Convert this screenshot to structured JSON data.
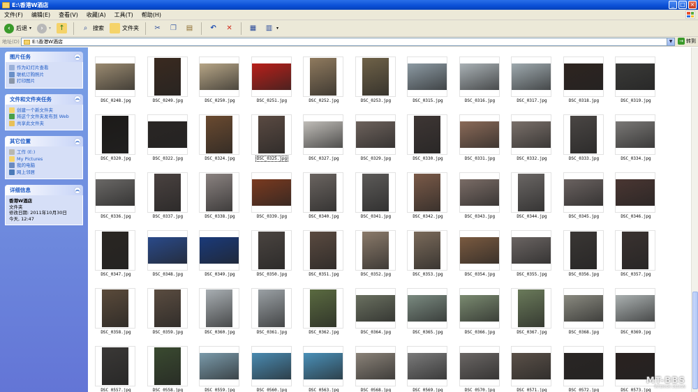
{
  "window": {
    "title": "E:\\香港W酒店"
  },
  "menu": [
    "文件(F)",
    "编辑(E)",
    "查看(V)",
    "收藏(A)",
    "工具(T)",
    "帮助(H)"
  ],
  "toolbar": {
    "back": "后退",
    "search": "搜索",
    "folders": "文件夹"
  },
  "address": {
    "label": "地址(D)",
    "path": "E:\\香港W酒店",
    "go": "转到"
  },
  "tasks_panels": [
    {
      "title": "图片任务",
      "items": [
        "作为幻灯片查看",
        "联机订购照片",
        "打印图片"
      ]
    },
    {
      "title": "文件和文件夹任务",
      "items": [
        "创建一个新文件夹",
        "将这个文件夹发布到 Web",
        "共享此文件夹"
      ]
    },
    {
      "title": "其它位置",
      "items": [
        "工作 (E:)",
        "My Pictures",
        "我的电脑",
        "网上邻居"
      ]
    }
  ],
  "details": {
    "title": "详细信息",
    "name": "香港W酒店",
    "type": "文件夹",
    "modified": "修改日期: 2011年10月30日",
    "time": "今天, 12:47"
  },
  "files": [
    {
      "name": "DSC_0248.jpg",
      "c": "#9a8a70",
      "o": "l"
    },
    {
      "name": "DSC_0249.jpg",
      "c": "#3a2a20",
      "o": "p"
    },
    {
      "name": "DSC_0250.jpg",
      "c": "#b6a586",
      "o": "l"
    },
    {
      "name": "DSC_0251.jpg",
      "c": "#b8201a",
      "o": "l"
    },
    {
      "name": "DSC_0252.jpg",
      "c": "#8f7a5e",
      "o": "p"
    },
    {
      "name": "DSC_0253.jpg",
      "c": "#6f6248",
      "o": "p"
    },
    {
      "name": "DSC_0315.jpg",
      "c": "#8c9aa3",
      "o": "l"
    },
    {
      "name": "DSC_0316.jpg",
      "c": "#a9b1b5",
      "o": "l"
    },
    {
      "name": "DSC_0317.jpg",
      "c": "#9ea9ae",
      "o": "l"
    },
    {
      "name": "DSC_0318.jpg",
      "c": "#2e2420",
      "o": "l"
    },
    {
      "name": "DSC_0319.jpg",
      "c": "#3a3a38",
      "o": "l"
    },
    {
      "name": "DSC_0320.jpg",
      "c": "#1c1a18",
      "o": "p"
    },
    {
      "name": "DSC_0322.jpg",
      "c": "#2a2624",
      "o": "l"
    },
    {
      "name": "DSC_0324.jpg",
      "c": "#6a4a30",
      "o": "p"
    },
    {
      "name": "DSC_0325.jpg",
      "c": "#5a4a42",
      "o": "p",
      "sel": true
    },
    {
      "name": "DSC_0327.jpg",
      "c": "#c0bdb8",
      "o": "l"
    },
    {
      "name": "DSC_0329.jpg",
      "c": "#6d625c",
      "o": "l"
    },
    {
      "name": "DSC_0330.jpg",
      "c": "#3e3634",
      "o": "p"
    },
    {
      "name": "DSC_0331.jpg",
      "c": "#8a6a58",
      "o": "l"
    },
    {
      "name": "DSC_0332.jpg",
      "c": "#7a706a",
      "o": "l"
    },
    {
      "name": "DSC_0333.jpg",
      "c": "#4a4644",
      "o": "p"
    },
    {
      "name": "DSC_0334.jpg",
      "c": "#7a7876",
      "o": "l"
    },
    {
      "name": "DSC_0336.jpg",
      "c": "#6a6866",
      "o": "l"
    },
    {
      "name": "DSC_0337.jpg",
      "c": "#4a4240",
      "o": "p"
    },
    {
      "name": "DSC_0338.jpg",
      "c": "#8a8280",
      "o": "p"
    },
    {
      "name": "DSC_0339.jpg",
      "c": "#7a3a20",
      "o": "l"
    },
    {
      "name": "DSC_0340.jpg",
      "c": "#6a6460",
      "o": "p"
    },
    {
      "name": "DSC_0341.jpg",
      "c": "#5c5a58",
      "o": "p"
    },
    {
      "name": "DSC_0342.jpg",
      "c": "#7a5a48",
      "o": "p"
    },
    {
      "name": "DSC_0343.jpg",
      "c": "#7a6c66",
      "o": "l"
    },
    {
      "name": "DSC_0344.jpg",
      "c": "#6a6664",
      "o": "p"
    },
    {
      "name": "DSC_0345.jpg",
      "c": "#6a6260",
      "o": "l"
    },
    {
      "name": "DSC_0346.jpg",
      "c": "#4a3632",
      "o": "l"
    },
    {
      "name": "DSC_0347.jpg",
      "c": "#2a2622",
      "o": "p"
    },
    {
      "name": "DSC_0348.jpg",
      "c": "#2a4a8a",
      "o": "l"
    },
    {
      "name": "DSC_0349.jpg",
      "c": "#1a3a7a",
      "o": "l"
    },
    {
      "name": "DSC_0350.jpg",
      "c": "#4a4440",
      "o": "p"
    },
    {
      "name": "DSC_0351.jpg",
      "c": "#5a4a40",
      "o": "p"
    },
    {
      "name": "DSC_0352.jpg",
      "c": "#8a7a6a",
      "o": "p"
    },
    {
      "name": "DSC_0353.jpg",
      "c": "#7a6a5a",
      "o": "p"
    },
    {
      "name": "DSC_0354.jpg",
      "c": "#7a5a40",
      "o": "l"
    },
    {
      "name": "DSC_0355.jpg",
      "c": "#6a6462",
      "o": "l"
    },
    {
      "name": "DSC_0356.jpg",
      "c": "#3a3634",
      "o": "p"
    },
    {
      "name": "DSC_0357.jpg",
      "c": "#3a3230",
      "o": "p"
    },
    {
      "name": "DSC_0358.jpg",
      "c": "#5a4a3a",
      "o": "p"
    },
    {
      "name": "DSC_0359.jpg",
      "c": "#5a4c40",
      "o": "p"
    },
    {
      "name": "DSC_0360.jpg",
      "c": "#a8aeb2",
      "o": "p"
    },
    {
      "name": "DSC_0361.jpg",
      "c": "#9aa0a4",
      "o": "p"
    },
    {
      "name": "DSC_0362.jpg",
      "c": "#5a6a40",
      "o": "p"
    },
    {
      "name": "DSC_0364.jpg",
      "c": "#6a7060",
      "o": "l"
    },
    {
      "name": "DSC_0365.jpg",
      "c": "#7a8a80",
      "o": "l"
    },
    {
      "name": "DSC_0366.jpg",
      "c": "#7a8a70",
      "o": "l"
    },
    {
      "name": "DSC_0367.jpg",
      "c": "#6a7a5a",
      "o": "p"
    },
    {
      "name": "DSC_0368.jpg",
      "c": "#8a8a80",
      "o": "l"
    },
    {
      "name": "DSC_0369.jpg",
      "c": "#aab0b0",
      "o": "l"
    },
    {
      "name": "DSC_0557.jpg",
      "c": "#3a3836",
      "o": "p"
    },
    {
      "name": "DSC_0558.jpg",
      "c": "#3a4a30",
      "o": "p"
    },
    {
      "name": "DSC_0559.jpg",
      "c": "#7a9aaa",
      "o": "l"
    },
    {
      "name": "DSC_0560.jpg",
      "c": "#4a8ab0",
      "o": "l"
    },
    {
      "name": "DSC_0563.jpg",
      "c": "#4a90b8",
      "o": "l"
    },
    {
      "name": "DSC_0568.jpg",
      "c": "#8a8278",
      "o": "l"
    },
    {
      "name": "DSC_0569.jpg",
      "c": "#7a7a7a",
      "o": "l"
    },
    {
      "name": "DSC_0570.jpg",
      "c": "#6a6664",
      "o": "l"
    },
    {
      "name": "DSC_0571.jpg",
      "c": "#5a5048",
      "o": "l"
    },
    {
      "name": "DSC_0572.jpg",
      "c": "#2a2624",
      "o": "l"
    },
    {
      "name": "DSC_0573.jpg",
      "c": "#2a2220",
      "o": "l"
    }
  ],
  "watermark": {
    "main": "MT-BBS",
    "sub": "INTERIOR DESIGN"
  },
  "colors": {
    "titlebar": "#0a4fd6",
    "taskpane": "#6f8cdb",
    "link": "#215dc6"
  }
}
